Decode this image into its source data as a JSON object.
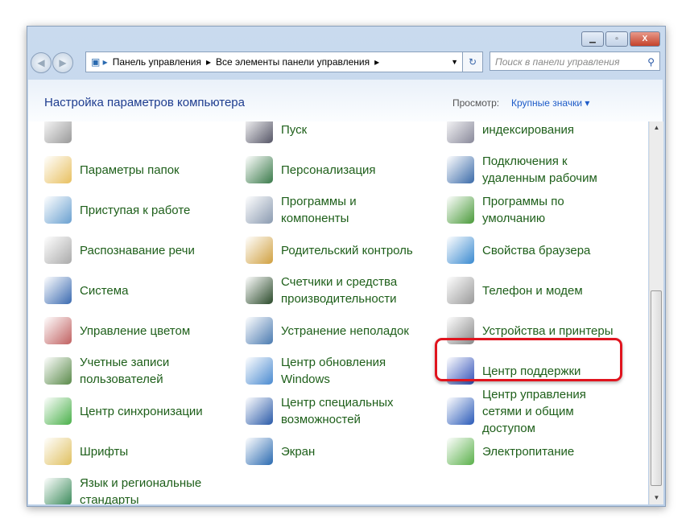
{
  "window": {
    "minimize": "▁",
    "maximize": "▫",
    "close": "X"
  },
  "nav": {
    "back": "◀",
    "forward": "▶",
    "breadcrumb": [
      "Панель управления",
      "Все элементы панели управления"
    ],
    "refresh": "↻",
    "search_placeholder": "Поиск в панели управления"
  },
  "header": {
    "title": "Настройка параметров компьютера",
    "view_label": "Просмотр:",
    "view_value": "Крупные значки ▾"
  },
  "items": [
    {
      "label": "",
      "icon": "generic-icon",
      "color": "#999"
    },
    {
      "label": "Пуск",
      "icon": "taskbar-icon",
      "color": "#556"
    },
    {
      "label": "индексирования",
      "icon": "indexing-icon",
      "color": "#889"
    },
    {
      "label": "Параметры папок",
      "icon": "folder-options-icon",
      "color": "#e8c060"
    },
    {
      "label": "Персонализация",
      "icon": "personalization-icon",
      "color": "#3a7a4a"
    },
    {
      "label": "Подключения к удаленным рабочим",
      "icon": "remote-desktop-icon",
      "color": "#3a6aa8"
    },
    {
      "label": "Приступая к работе",
      "icon": "getting-started-icon",
      "color": "#6aa0d0"
    },
    {
      "label": "Программы и компоненты",
      "icon": "programs-icon",
      "color": "#8a9ab0"
    },
    {
      "label": "Программы по умолчанию",
      "icon": "default-programs-icon",
      "color": "#4a9a3a"
    },
    {
      "label": "Распознавание речи",
      "icon": "microphone-icon",
      "color": "#aaa"
    },
    {
      "label": "Родительский контроль",
      "icon": "parental-control-icon",
      "color": "#d0a040"
    },
    {
      "label": "Свойства браузера",
      "icon": "internet-options-icon",
      "color": "#3a8ad0"
    },
    {
      "label": "Система",
      "icon": "system-icon",
      "color": "#3a6ab0"
    },
    {
      "label": "Счетчики и средства производительности",
      "icon": "performance-icon",
      "color": "#2a4a2a"
    },
    {
      "label": "Телефон и модем",
      "icon": "phone-modem-icon",
      "color": "#999"
    },
    {
      "label": "Управление цветом",
      "icon": "color-management-icon",
      "color": "#c06060"
    },
    {
      "label": "Устранение неполадок",
      "icon": "troubleshooting-icon",
      "color": "#4a7ab0"
    },
    {
      "label": "Устройства и принтеры",
      "icon": "printer-icon",
      "color": "#888"
    },
    {
      "label": "Учетные записи пользователей",
      "icon": "user-accounts-icon",
      "color": "#5a8a4a"
    },
    {
      "label": "Центр обновления Windows",
      "icon": "windows-update-icon",
      "color": "#4a8ad0"
    },
    {
      "label": "Центр поддержки",
      "icon": "flag-icon",
      "color": "#3050b8"
    },
    {
      "label": "Центр синхронизации",
      "icon": "sync-center-icon",
      "color": "#4ab04a"
    },
    {
      "label": "Центр специальных возможностей",
      "icon": "accessibility-icon",
      "color": "#2a5aa8"
    },
    {
      "label": "Центр управления сетями и общим доступом",
      "icon": "network-icon",
      "color": "#2a5ab8"
    },
    {
      "label": "Шрифты",
      "icon": "fonts-icon",
      "color": "#e0c060"
    },
    {
      "label": "Экран",
      "icon": "display-icon",
      "color": "#2a6ab0"
    },
    {
      "label": "Электропитание",
      "icon": "power-icon",
      "color": "#5ab04a"
    },
    {
      "label": "Язык и региональные стандарты",
      "icon": "region-language-icon",
      "color": "#3a8a5a"
    }
  ]
}
